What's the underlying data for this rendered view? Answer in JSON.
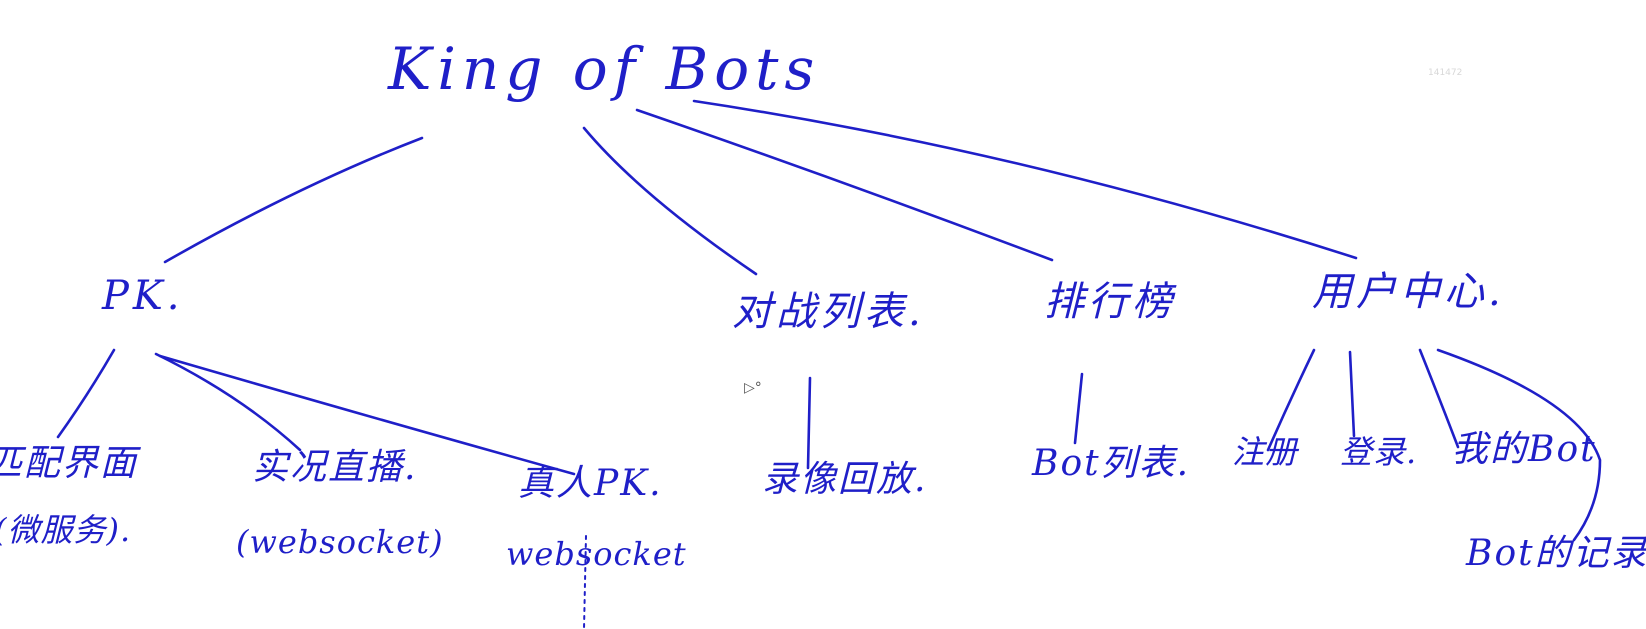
{
  "colors": {
    "ink": "#1f1fc8",
    "background": "#ffffff",
    "watermark": "#d8d8d8"
  },
  "root": "King of Bots",
  "branches": {
    "pk": "PK.",
    "battle_list": "对战列表.",
    "ranking": "排行榜",
    "user_center": "用户中心."
  },
  "leaves": {
    "pk_match": "匹配界面",
    "pk_match_service": "(微服务).",
    "pk_live": "实况直播.",
    "pk_live_tech": "(websocket)",
    "pk_human": "真人PK.",
    "pk_human_tech": "websocket",
    "battle_replay": "录像回放.",
    "ranking_bot_list": "Bot列表.",
    "user_register": "注册",
    "user_login": "登录.",
    "user_my_bot": "我的Bot",
    "user_bot_record": "Bot的记录."
  },
  "watermark_text": "141472",
  "cursor_icon": "cursor-icon"
}
